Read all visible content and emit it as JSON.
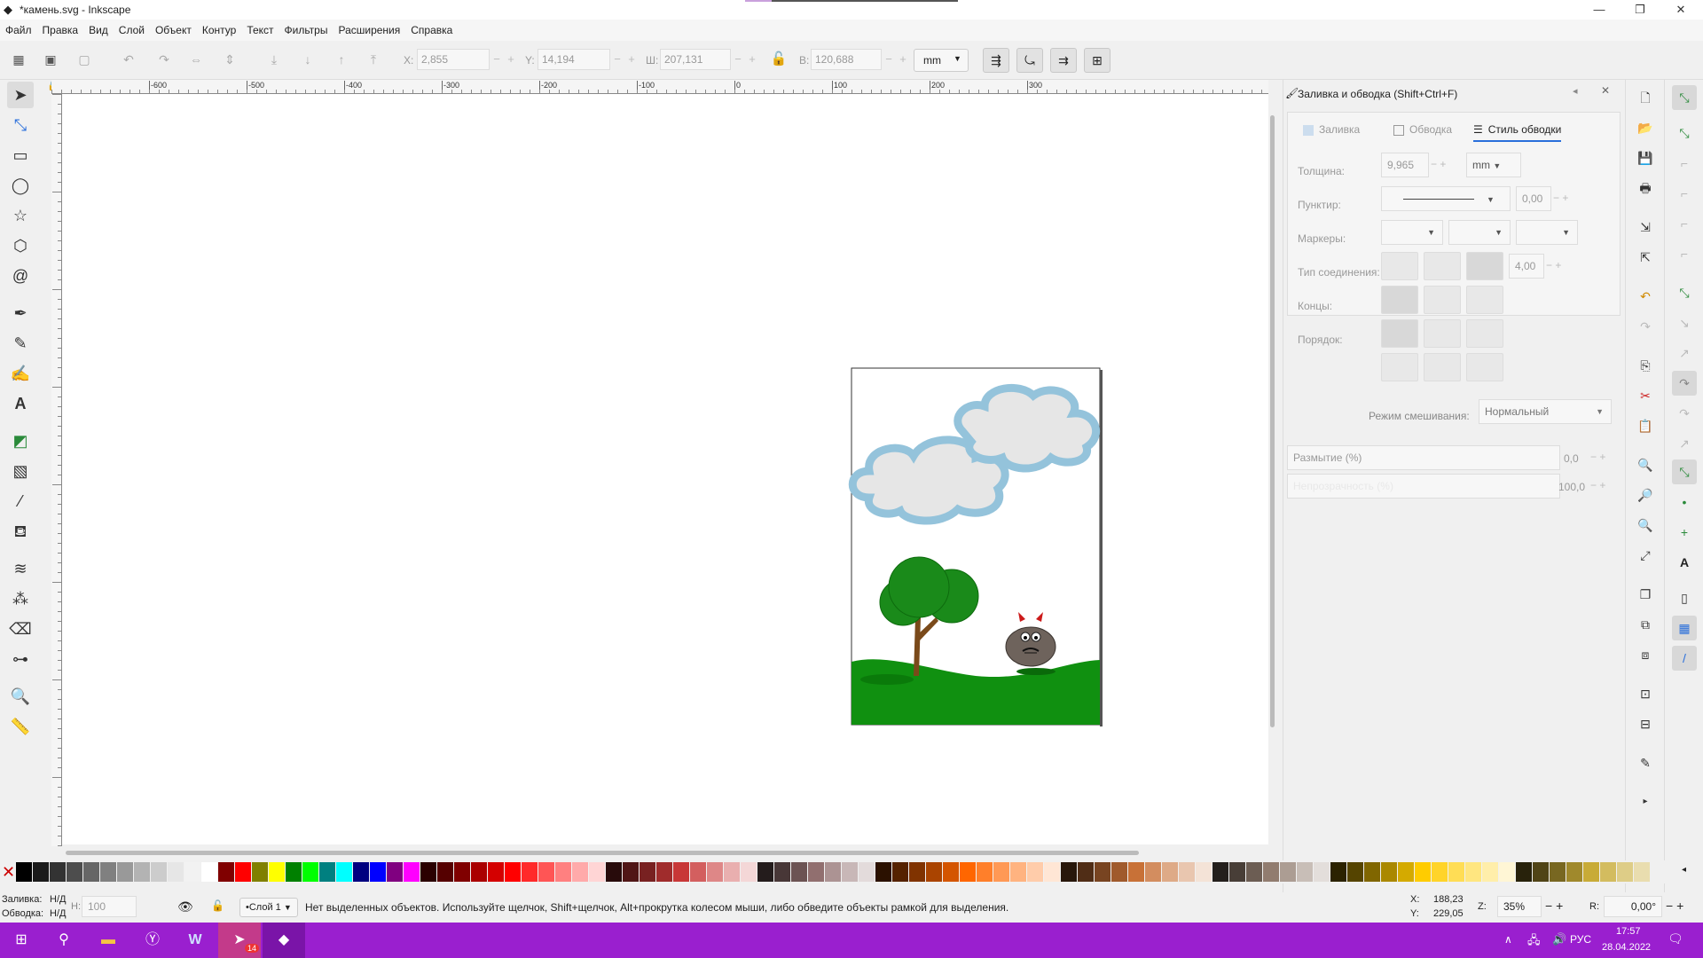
{
  "window": {
    "title": "*камень.svg - Inkscape",
    "minimize": "—",
    "maximize": "❐",
    "close": "✕"
  },
  "menu": [
    "Файл",
    "Правка",
    "Вид",
    "Слой",
    "Объект",
    "Контур",
    "Текст",
    "Фильтры",
    "Расширения",
    "Справка"
  ],
  "toolbar": {
    "x_label": "X:",
    "x_value": "2,855",
    "y_label": "Y:",
    "y_value": "14,194",
    "w_label": "Ш:",
    "w_value": "207,131",
    "h_label": "В:",
    "h_value": "120,688",
    "unit": "mm"
  },
  "ruler_labels": [
    "-600",
    "-500",
    "-400",
    "-300",
    "-200",
    "-100",
    "0",
    "100",
    "200",
    "300"
  ],
  "panel": {
    "title": "Заливка и обводка (Shift+Ctrl+F)",
    "tabs": [
      "Заливка",
      "Обводка",
      "Стиль обводки"
    ],
    "active_tab": "Стиль обводки",
    "width_label": "Толщина:",
    "width_value": "9,965",
    "width_unit": "mm",
    "dash_label": "Пунктир:",
    "dash_value": "0,00",
    "markers_label": "Маркеры:",
    "join_label": "Тип соединения:",
    "join_value": "4,00",
    "caps_label": "Концы:",
    "order_label": "Порядок:",
    "blend_label": "Режим смешивания:",
    "blend_value": "Нормальный",
    "blur_label": "Размытие (%)",
    "blur_value": "0,0",
    "opacity_label": "Непрозрачность (%)",
    "opacity_value": "100,0"
  },
  "status": {
    "fill_label": "Заливка:",
    "fill_value": "Н/Д",
    "stroke_label": "Обводка:",
    "stroke_value": "Н/Д",
    "h_label": "Н:",
    "h_value": "100",
    "layer": "•Слой 1",
    "message": "Нет выделенных объектов. Используйте щелчок, Shift+щелчок, Alt+прокрутка колесом мыши, либо обведите объекты рамкой для выделения.",
    "cx_label": "X:",
    "cx_value": "188,23",
    "cy_label": "Y:",
    "cy_value": "229,05",
    "zoom_label": "Z:",
    "zoom_value": "35%",
    "rot_label": "R:",
    "rot_value": "0,00°"
  },
  "taskbar": {
    "lang": "РУС",
    "time": "17:57",
    "date": "28.04.2022",
    "badge": "14"
  },
  "palette_colors": [
    "#000000",
    "#1a1a1a",
    "#333333",
    "#4d4d4d",
    "#666666",
    "#808080",
    "#999999",
    "#b3b3b3",
    "#cccccc",
    "#e6e6e6",
    "#f2f2f2",
    "#ffffff",
    "#800000",
    "#ff0000",
    "#808000",
    "#ffff00",
    "#008000",
    "#00ff00",
    "#008080",
    "#00ffff",
    "#000080",
    "#0000ff",
    "#800080",
    "#ff00ff",
    "#2b0000",
    "#550000",
    "#800000",
    "#aa0000",
    "#d40000",
    "#ff0000",
    "#ff2a2a",
    "#ff5555",
    "#ff8080",
    "#ffaaaa",
    "#ffd5d5",
    "#280b0b",
    "#501616",
    "#782121",
    "#a02c2c",
    "#c83737",
    "#d35f5f",
    "#de8787",
    "#e9afaf",
    "#f4d7d7",
    "#241c1c",
    "#483737",
    "#6c5353",
    "#916f6f",
    "#ac9393",
    "#c8b7b7",
    "#e3dbdb",
    "#2b1100",
    "#552200",
    "#803300",
    "#aa4400",
    "#d45500",
    "#ff6600",
    "#ff7f2a",
    "#ff9955",
    "#ffb380",
    "#ffccaa",
    "#ffe6d5",
    "#28170b",
    "#502d16",
    "#784421",
    "#a05a2c",
    "#c87137",
    "#d38d5f",
    "#deaa87",
    "#e9c6af",
    "#f4e3d7",
    "#241f1c",
    "#483e37",
    "#6c5d53",
    "#917c6f",
    "#ac9d93",
    "#c8beb7",
    "#e3dedb",
    "#2b2200",
    "#554400",
    "#806600",
    "#aa8800",
    "#d4aa00",
    "#ffcc00",
    "#ffd42a",
    "#ffdd55",
    "#ffe680",
    "#ffeeaa",
    "#fff6d5",
    "#28220b",
    "#504416",
    "#786721",
    "#a0892c",
    "#c8ab37",
    "#d3bc5f",
    "#decd87",
    "#e9ddaf"
  ]
}
